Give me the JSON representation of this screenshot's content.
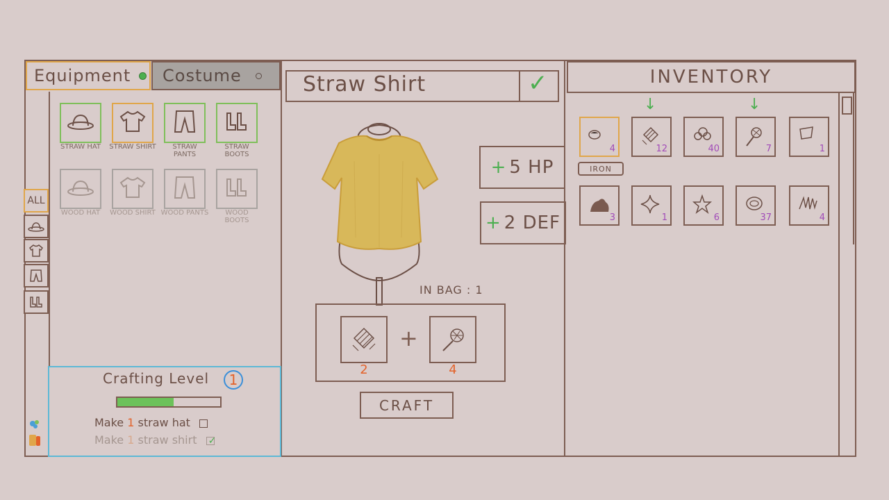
{
  "tabs": {
    "equipment": "Equipment",
    "costume": "Costume"
  },
  "filters": [
    "ALL"
  ],
  "equipment_items": [
    {
      "label": "STRAW HAT",
      "icon": "hat-icon",
      "state": "available"
    },
    {
      "label": "STRAW SHIRT",
      "icon": "shirt-icon",
      "state": "selected"
    },
    {
      "label": "STRAW PANTS",
      "icon": "pants-icon",
      "state": "available"
    },
    {
      "label": "STRAW BOOTS",
      "icon": "boots-icon",
      "state": "available"
    },
    {
      "label": "WOOD HAT",
      "icon": "hat-icon",
      "state": "locked"
    },
    {
      "label": "WOOD SHIRT",
      "icon": "shirt-icon",
      "state": "locked"
    },
    {
      "label": "WOOD PANTS",
      "icon": "pants-icon",
      "state": "locked"
    },
    {
      "label": "WOOD BOOTS",
      "icon": "boots-icon",
      "state": "locked"
    }
  ],
  "crafting": {
    "title": "Crafting Level",
    "level": "1",
    "progress": 0.55,
    "quests": [
      {
        "pre": "Make",
        "num": "1",
        "post": "straw hat",
        "done": false
      },
      {
        "pre": "Make",
        "num": "1",
        "post": "straw shirt",
        "done": true
      }
    ]
  },
  "item": {
    "name": "Straw Shirt",
    "stats": [
      {
        "plus": "+",
        "text": "5 HP"
      },
      {
        "plus": "+",
        "text": "2 DEF"
      }
    ],
    "in_bag": "IN BAG : 1",
    "recipe": [
      {
        "icon": "straw-bundle-icon",
        "count": "2"
      },
      {
        "icon": "cotton-icon",
        "count": "4"
      }
    ],
    "craft_label": "CRAFT"
  },
  "inventory": {
    "title": "INVENTORY",
    "tooltip": "IRON",
    "items": [
      {
        "icon": "iron-icon",
        "count": "4",
        "selected": true,
        "arrow": false
      },
      {
        "icon": "straw-bundle-icon",
        "count": "12",
        "selected": false,
        "arrow": true
      },
      {
        "icon": "stones-icon",
        "count": "40",
        "selected": false,
        "arrow": false
      },
      {
        "icon": "cotton-icon",
        "count": "7",
        "selected": false,
        "arrow": true
      },
      {
        "icon": "leather-icon",
        "count": "1",
        "selected": false,
        "arrow": false
      },
      {
        "icon": "clay-icon",
        "count": "3",
        "selected": false,
        "arrow": false
      },
      {
        "icon": "sparkle-icon",
        "count": "1",
        "selected": false,
        "arrow": false
      },
      {
        "icon": "star-icon",
        "count": "6",
        "selected": false,
        "arrow": false
      },
      {
        "icon": "thread-icon",
        "count": "37",
        "selected": false,
        "arrow": false
      },
      {
        "icon": "fiber-icon",
        "count": "4",
        "selected": false,
        "arrow": false
      }
    ]
  },
  "colors": {
    "background": "#d9cccb",
    "outline": "#7d5d52",
    "selected": "#e0a64a",
    "available": "#7fbf5a",
    "count": "#a14bb8",
    "recipe_count": "#e3622a",
    "shirt": "#d8b85a"
  }
}
